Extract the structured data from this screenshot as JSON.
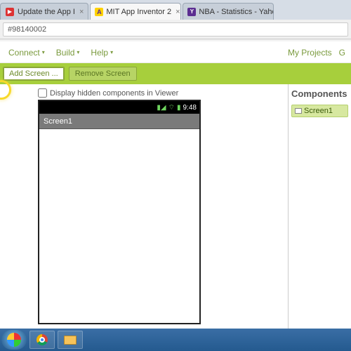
{
  "tabs": [
    {
      "label": "Update the App I",
      "active": false,
      "favicon": "red"
    },
    {
      "label": "MIT App Inventor 2",
      "active": true,
      "favicon": "yellow"
    },
    {
      "label": "NBA - Statistics - Yahoo S",
      "active": false,
      "favicon": "purple"
    }
  ],
  "address": "#98140002",
  "menu": {
    "connect": "Connect",
    "build": "Build",
    "help": "Help",
    "myprojects": "My Projects",
    "right2": "G"
  },
  "buttons": {
    "add_screen": "Add Screen ...",
    "remove_screen": "Remove Screen"
  },
  "viewer": {
    "hidden_label": "Display hidden components in Viewer",
    "screen_title": "Screen1",
    "clock": "9:48"
  },
  "components": {
    "heading": "Components",
    "root": "Screen1"
  }
}
